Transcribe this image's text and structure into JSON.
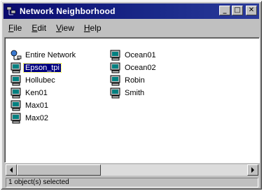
{
  "window": {
    "title": "Network Neighborhood"
  },
  "title_buttons": {
    "minimize": "_",
    "maximize": "□",
    "close": "✕"
  },
  "menu": [
    {
      "first": "F",
      "rest": "ile"
    },
    {
      "first": "E",
      "rest": "dit"
    },
    {
      "first": "V",
      "rest": "iew"
    },
    {
      "first": "H",
      "rest": "elp"
    }
  ],
  "items_col1": [
    {
      "label": "Entire Network",
      "icon": "network-globe-icon",
      "selected": false
    },
    {
      "label": "Epson_tpi",
      "icon": "computer-icon",
      "selected": true
    },
    {
      "label": "Hollubec",
      "icon": "computer-icon",
      "selected": false
    },
    {
      "label": "Ken01",
      "icon": "computer-icon",
      "selected": false
    },
    {
      "label": "Max01",
      "icon": "computer-icon",
      "selected": false
    },
    {
      "label": "Max02",
      "icon": "computer-icon",
      "selected": false
    }
  ],
  "items_col2": [
    {
      "label": "Ocean01",
      "icon": "computer-icon",
      "selected": false
    },
    {
      "label": "Ocean02",
      "icon": "computer-icon",
      "selected": false
    },
    {
      "label": "Robin",
      "icon": "computer-icon",
      "selected": false
    },
    {
      "label": "Smith",
      "icon": "computer-icon",
      "selected": false
    }
  ],
  "status": {
    "text": "1 object(s) selected"
  },
  "colors": {
    "titlebar": "#0a0a6e",
    "selection": "#000080",
    "chrome": "#c0c0c0"
  }
}
